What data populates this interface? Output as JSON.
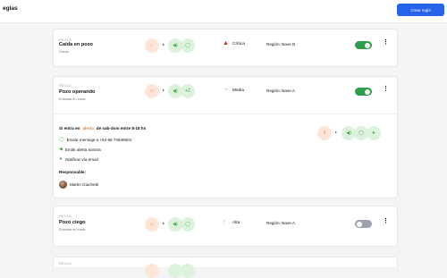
{
  "header": {
    "title": "eglas",
    "create_button": "Crear regla"
  },
  "rules": [
    {
      "tag": "REGLA",
      "name": "Caída en pozo",
      "subtitle": "Caída",
      "severity": "Crítica",
      "severity_icon": "warning-triangle-icon",
      "severity_color": "#dc2626",
      "region": "Región: Nave B",
      "enabled": true
    },
    {
      "tag": "REGLA",
      "name": "Pozo operando",
      "subtitle": "Entrada en zona",
      "severity": "Media",
      "severity_icon": "arrow-right-icon",
      "severity_color": "#22a04a",
      "region": "Región: Nave A",
      "enabled": true,
      "extra_badge": "+2"
    },
    {
      "tag": "REGLA",
      "name": "Pozo ciego",
      "subtitle": "Entrada en zona",
      "severity": "Alta",
      "severity_icon": "arrow-up-icon",
      "severity_color": "#ea7d25",
      "region": "Región: Nave A",
      "enabled": false
    },
    {
      "tag": "REGLA"
    }
  ],
  "detail": {
    "schedule_prefix": "Si entra en ",
    "schedule_highlight": "alerta",
    "schedule_suffix": " de sab-dom entre 8-18 hs",
    "actions": [
      "Enviar mensaje a +54 66 74649601",
      "Emitir alerta sonora",
      "Notificar vía email"
    ],
    "responsible_label": "Responsable:",
    "responsible_name": "Martin Giachetti"
  },
  "colors": {
    "accent": "#2563eb",
    "toggle_on": "#2e9e4a",
    "toggle_off": "#9ca3af",
    "trigger_bg": "#fde6d6",
    "action_bg": "#dcf2dc"
  }
}
